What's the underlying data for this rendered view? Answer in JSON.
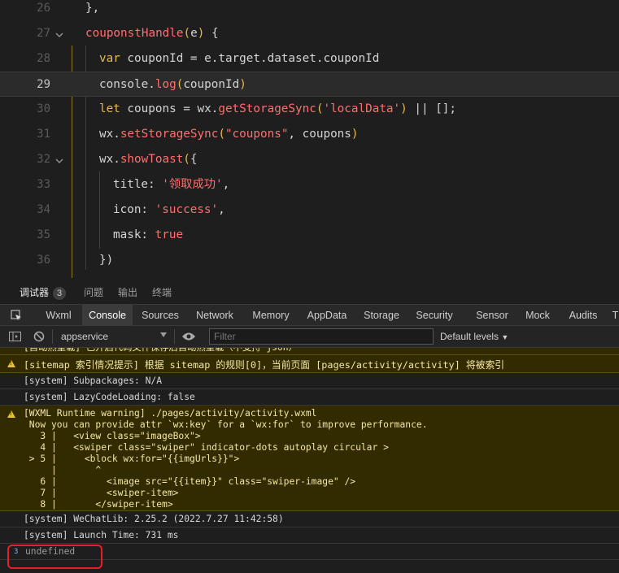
{
  "editor": {
    "lines": [
      {
        "num": "26",
        "tokens": [
          [
            "pr",
            "},"
          ]
        ],
        "indent": 105
      },
      {
        "num": "27",
        "tokens": [
          [
            "fn",
            "couponstHandle"
          ],
          [
            "br",
            "("
          ],
          [
            "pr",
            "e"
          ],
          [
            "br",
            ")"
          ],
          [
            "pr",
            " {"
          ]
        ],
        "indent": 105
      },
      {
        "num": "28",
        "tokens": [
          [
            "kw",
            "var"
          ],
          [
            "pr",
            " couponId = e.target.dataset.couponId"
          ]
        ],
        "indent": 122
      },
      {
        "num": "29",
        "tokens": [
          [
            "pr",
            "console."
          ],
          [
            "fn",
            "log"
          ],
          [
            "br",
            "("
          ],
          [
            "pr",
            "couponId"
          ],
          [
            "br",
            ")"
          ]
        ],
        "indent": 122
      },
      {
        "num": "30",
        "tokens": [
          [
            "kw",
            "let"
          ],
          [
            "pr",
            " coupons = wx."
          ],
          [
            "fn",
            "getStorageSync"
          ],
          [
            "br",
            "("
          ],
          [
            "st",
            "'localData'"
          ],
          [
            "br",
            ")"
          ],
          [
            "pr",
            " || [];"
          ]
        ],
        "indent": 122
      },
      {
        "num": "31",
        "tokens": [
          [
            "pr",
            "wx."
          ],
          [
            "fn",
            "setStorageSync"
          ],
          [
            "br",
            "("
          ],
          [
            "st",
            "\"coupons\""
          ],
          [
            "pr",
            ", coupons"
          ],
          [
            "br",
            ")"
          ]
        ],
        "indent": 122
      },
      {
        "num": "32",
        "tokens": [
          [
            "pr",
            "wx."
          ],
          [
            "fn",
            "showToast"
          ],
          [
            "br",
            "("
          ],
          [
            "pr",
            "{"
          ]
        ],
        "indent": 122
      },
      {
        "num": "33",
        "tokens": [
          [
            "pr",
            "title: "
          ],
          [
            "st",
            "'领取成功'"
          ],
          [
            "pr",
            ","
          ]
        ],
        "indent": 139
      },
      {
        "num": "34",
        "tokens": [
          [
            "pr",
            "icon: "
          ],
          [
            "st",
            "'success'"
          ],
          [
            "pr",
            ","
          ]
        ],
        "indent": 139
      },
      {
        "num": "35",
        "tokens": [
          [
            "pr",
            "mask: "
          ],
          [
            "bool",
            "true"
          ]
        ],
        "indent": 139
      },
      {
        "num": "36",
        "tokens": [
          [
            "pr",
            "})"
          ]
        ],
        "indent": 122
      }
    ],
    "current_line": "29"
  },
  "panel_tabs": [
    {
      "label": "调试器",
      "badge": "3",
      "active": true
    },
    {
      "label": "问题",
      "active": false
    },
    {
      "label": "输出",
      "active": false
    },
    {
      "label": "终端",
      "active": false
    }
  ],
  "devtools_tabs": [
    "Wxml",
    "Console",
    "Sources",
    "Network",
    "Memory",
    "AppData",
    "Storage",
    "Security",
    "Sensor",
    "Mock",
    "Audits",
    "T"
  ],
  "active_devtools_tab": "Console",
  "toolbar": {
    "context": "appservice",
    "filter_placeholder": "Filter",
    "levels": "Default levels"
  },
  "console": {
    "clipped_top": "[自动热重载] 已开启代码文件保存后自动热重载（不支持 json）",
    "sitemap_warning": "[sitemap 索引情况提示] 根据 sitemap 的规则[0]，当前页面 [pages/activity/activity] 将被索引",
    "subpackages": "[system] Subpackages: N/A",
    "lazy": "[system] LazyCodeLoading: false",
    "wxml_warning_lines": [
      "[WXML Runtime warning] ./pages/activity/activity.wxml",
      " Now you can provide attr `wx:key` for a `wx:for` to improve performance.",
      "   3 |   <view class=\"imageBox\">",
      "   4 |   <swiper class=\"swiper\" indicator-dots autoplay circular >",
      " > 5 |     <block wx:for=\"{{imgUrls}}\">",
      "     |       ^",
      "   6 |         <image src=\"{{item}}\" class=\"swiper-image\" />",
      "   7 |         <swiper-item>",
      "   8 |       </swiper-item>"
    ],
    "wechatlib": "[system] WeChatLib: 2.25.2 (2022.7.27 11:42:58)",
    "launch": "[system] Launch Time: 731 ms",
    "result_badge": "3",
    "result": "undefined"
  },
  "colors": {
    "keyword": "#e7ba4a",
    "function": "#ff6f6f",
    "warning_bg": "#332b00",
    "annotation": "#e4202a"
  }
}
